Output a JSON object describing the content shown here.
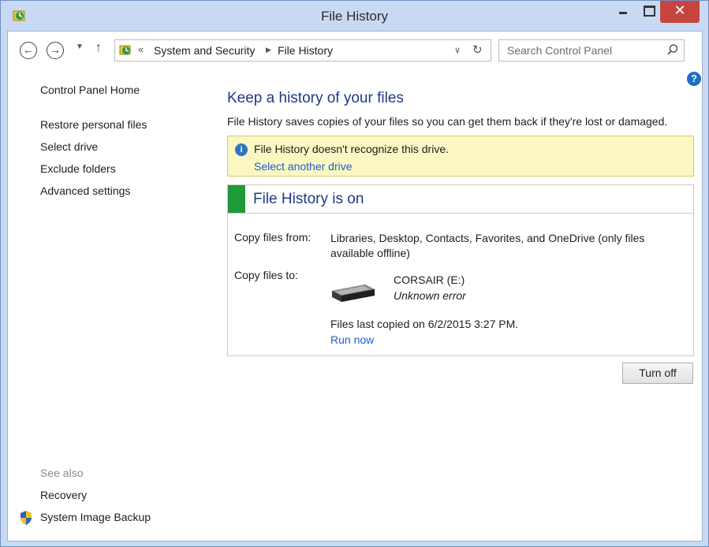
{
  "window": {
    "title": "File History"
  },
  "window_controls": {
    "close_glyph": "✕"
  },
  "navigation": {
    "back_glyph": "←",
    "forward_glyph": "→",
    "up_glyph": "↑",
    "breadcrumb_prefix": "«",
    "breadcrumbs": [
      "System and Security",
      "File History"
    ],
    "breadcrumb_separator": "▶",
    "dropdown_glyph": "∨",
    "refresh_glyph": "↻"
  },
  "search": {
    "placeholder": "Search Control Panel"
  },
  "sidebar": {
    "home": "Control Panel Home",
    "items": [
      {
        "label": "Restore personal files"
      },
      {
        "label": "Select drive"
      },
      {
        "label": "Exclude folders"
      },
      {
        "label": "Advanced settings"
      }
    ],
    "see_also_heading": "See also",
    "see_also": [
      {
        "label": "Recovery"
      },
      {
        "label": "System Image Backup",
        "icon": "shield-icon"
      }
    ]
  },
  "help": {
    "glyph": "?"
  },
  "main": {
    "heading": "Keep a history of your files",
    "description": "File History saves copies of your files so you can get them back if they're lost or damaged.",
    "warning": {
      "icon_glyph": "i",
      "text": "File History doesn't recognize this drive.",
      "link": "Select another drive"
    },
    "status": {
      "title": "File History is on",
      "indicator_color": "#1e9a3a",
      "copy_from_label": "Copy files from:",
      "copy_from_value": "Libraries, Desktop, Contacts, Favorites, and OneDrive (only files available offline)",
      "copy_to_label": "Copy files to:",
      "drive_name": "CORSAIR (E:)",
      "drive_status": "Unknown error",
      "last_copied": "Files last copied on 6/2/2015 3:27 PM.",
      "run_now": "Run now"
    },
    "turn_off_button": "Turn off"
  },
  "colors": {
    "link": "#1f5ec4",
    "heading": "#1e3a8a",
    "warning_bg": "#fbf7c3",
    "close_button": "#c7453f"
  }
}
